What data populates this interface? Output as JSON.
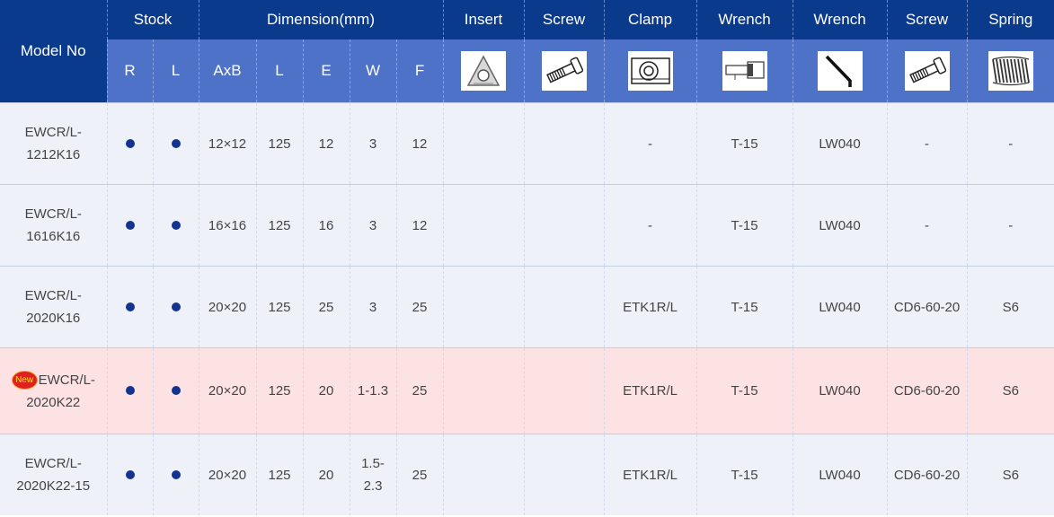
{
  "header": {
    "model_no": "Model No",
    "groups": {
      "stock": "Stock",
      "dimension": "Dimension(mm)",
      "insert": "Insert",
      "screw1": "Screw",
      "clamp": "Clamp",
      "wrench1": "Wrench",
      "wrench2": "Wrench",
      "screw2": "Screw",
      "spring": "Spring"
    },
    "sub": {
      "r": "R",
      "l": "L",
      "axb": "AxB",
      "dim_l": "L",
      "e": "E",
      "w": "W",
      "f": "F"
    },
    "icons": [
      "insert-icon",
      "screw-icon",
      "clamp-icon",
      "wrench-t-icon",
      "hex-key-icon",
      "screw-icon",
      "spring-icon"
    ]
  },
  "colors": {
    "header_dark": "#0a3a8c",
    "header_light": "#4f72c9",
    "row_bg": "#eef2f8",
    "new_row_bg": "#fde2e4",
    "dot": "#14338f",
    "new_badge": "#e02020"
  },
  "rows": [
    {
      "model_line1": "EWCR/L-",
      "model_line2": "1212K16",
      "new": false,
      "r": true,
      "l": true,
      "axb": "12×12",
      "l_dim": "125",
      "e": "12",
      "w": "3",
      "f": "12",
      "insert": "",
      "screw1": "",
      "clamp": "-",
      "wrench1": "T-15",
      "wrench2": "LW040",
      "screw2": "-",
      "spring": "-"
    },
    {
      "model_line1": "EWCR/L-",
      "model_line2": "1616K16",
      "new": false,
      "r": true,
      "l": true,
      "axb": "16×16",
      "l_dim": "125",
      "e": "16",
      "w": "3",
      "f": "12",
      "insert": "",
      "screw1": "",
      "clamp": "-",
      "wrench1": "T-15",
      "wrench2": "LW040",
      "screw2": "-",
      "spring": "-"
    },
    {
      "model_line1": "EWCR/L-",
      "model_line2": "2020K16",
      "new": false,
      "r": true,
      "l": true,
      "axb": "20×20",
      "l_dim": "125",
      "e": "25",
      "w": "3",
      "f": "25",
      "insert": "",
      "screw1": "",
      "clamp": "ETK1R/L",
      "wrench1": "T-15",
      "wrench2": "LW040",
      "screw2": "CD6-60-20",
      "spring": "S6"
    },
    {
      "model_line1": "EWCR/L-",
      "model_line2": "2020K22",
      "new": true,
      "new_label": "New",
      "r": true,
      "l": true,
      "axb": "20×20",
      "l_dim": "125",
      "e": "20",
      "w": "1-1.3",
      "f": "25",
      "insert": "",
      "screw1": "",
      "clamp": "ETK1R/L",
      "wrench1": "T-15",
      "wrench2": "LW040",
      "screw2": "CD6-60-20",
      "spring": "S6"
    },
    {
      "model_line1": "EWCR/L-",
      "model_line2": "2020K22-15",
      "new": false,
      "r": true,
      "l": true,
      "axb": "20×20",
      "l_dim": "125",
      "e": "20",
      "w_line1": "1.5-",
      "w_line2": "2.3",
      "f": "25",
      "insert": "",
      "screw1": "",
      "clamp": "ETK1R/L",
      "wrench1": "T-15",
      "wrench2": "LW040",
      "screw2": "CD6-60-20",
      "spring": "S6"
    }
  ]
}
